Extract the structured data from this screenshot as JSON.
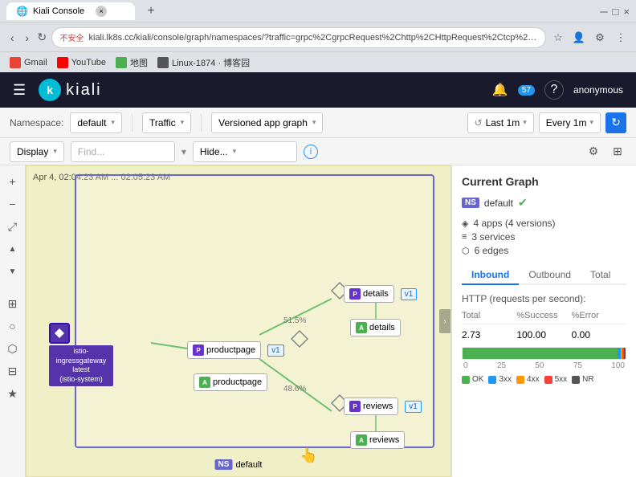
{
  "browser": {
    "tab_title": "Kiali Console",
    "address": "kiali.lk8s.cc/kiali/console/graph/namespaces/?traffic=grpc%2CgrpcRequest%2Chttp%2CHttpRequest%2Ctcp%2Ctcp...",
    "address_full": "不安全 | kiali.lk8s.cc/kiali/console/graph/namespaces/?traffic=grpc%2CgrpcRequest%2Chttp%2CHttpRequest%2Ctcp%2Ctcp...",
    "security_label": "不安全",
    "new_tab_label": "+",
    "bookmarks": [
      {
        "name": "Gmail",
        "color": "#ea4335"
      },
      {
        "name": "YouTube",
        "color": "#ff0000"
      },
      {
        "name": "地图",
        "color": "#4caf50"
      },
      {
        "name": "Linux-1874 · 博客园",
        "color": "#555"
      }
    ]
  },
  "header": {
    "menu_icon": "☰",
    "logo_letter": "k",
    "logo_text": "kiali",
    "bell_icon": "🔔",
    "notification_count": "57",
    "help_icon": "?",
    "user_label": "anonymous"
  },
  "toolbar1": {
    "namespace_label": "Namespace:",
    "namespace_value": "default",
    "traffic_label": "Traffic",
    "graph_type_label": "Versioned app graph",
    "time_icon": "↺",
    "last_time_label": "Last 1m",
    "every_label": "Every 1m",
    "refresh_icon": "↻"
  },
  "toolbar2": {
    "display_label": "Display",
    "find_placeholder": "Find...",
    "hide_placeholder": "Hide...",
    "info_icon": "i"
  },
  "graph": {
    "timestamp": "Apr 4, 02:04:23 AM ... 02:05:23 AM",
    "namespace_label": "default",
    "nodes": [
      {
        "id": "ingressgateway",
        "label": "istio-ingressgateway\nlatest\n(istio-system)",
        "type": "gateway"
      },
      {
        "id": "productpage",
        "label": "productpage",
        "type": "workload",
        "badge": "P",
        "version": "v1"
      },
      {
        "id": "productpage-app",
        "label": "productpage",
        "type": "app",
        "badge": "A"
      },
      {
        "id": "details",
        "label": "details",
        "type": "workload",
        "badge": "P",
        "version": "v1"
      },
      {
        "id": "details-app",
        "label": "details",
        "type": "app",
        "badge": "A"
      },
      {
        "id": "reviews",
        "label": "reviews",
        "type": "workload",
        "badge": "P",
        "version": "v1"
      },
      {
        "id": "reviews-app",
        "label": "reviews",
        "type": "app",
        "badge": "A"
      }
    ],
    "edge_labels": [
      {
        "id": "e1",
        "label": "51.5%"
      },
      {
        "id": "e2",
        "label": "48.6%"
      }
    ]
  },
  "right_panel": {
    "title": "Current Graph",
    "namespace_badge": "NS",
    "namespace_name": "default",
    "stats": [
      {
        "icon": "◈",
        "text": "4 apps (4 versions)"
      },
      {
        "icon": "≡",
        "text": "3 services"
      },
      {
        "icon": "⬡",
        "text": "6 edges"
      }
    ],
    "tabs": [
      "Inbound",
      "Outbound",
      "Total"
    ],
    "active_tab": "Inbound",
    "section_title": "HTTP (requests per second):",
    "table_headers": [
      "Total",
      "%Success",
      "%Error"
    ],
    "table_values": [
      "2.73",
      "100.00",
      "0.00"
    ],
    "chart_x_labels": [
      "0",
      "25",
      "50",
      "75",
      "100"
    ],
    "legend": [
      {
        "label": "OK",
        "color": "#4caf50"
      },
      {
        "label": "3xx",
        "color": "#2196f3"
      },
      {
        "label": "4xx",
        "color": "#ff9800"
      },
      {
        "label": "5xx",
        "color": "#f44336"
      },
      {
        "label": "NR",
        "color": "#555"
      }
    ]
  },
  "sidebar": {
    "icons": [
      "⊕",
      "⊖",
      "⤢",
      "↑",
      "↓",
      "⊞",
      "⊠",
      "⊡",
      "⊟",
      "⊛"
    ]
  }
}
